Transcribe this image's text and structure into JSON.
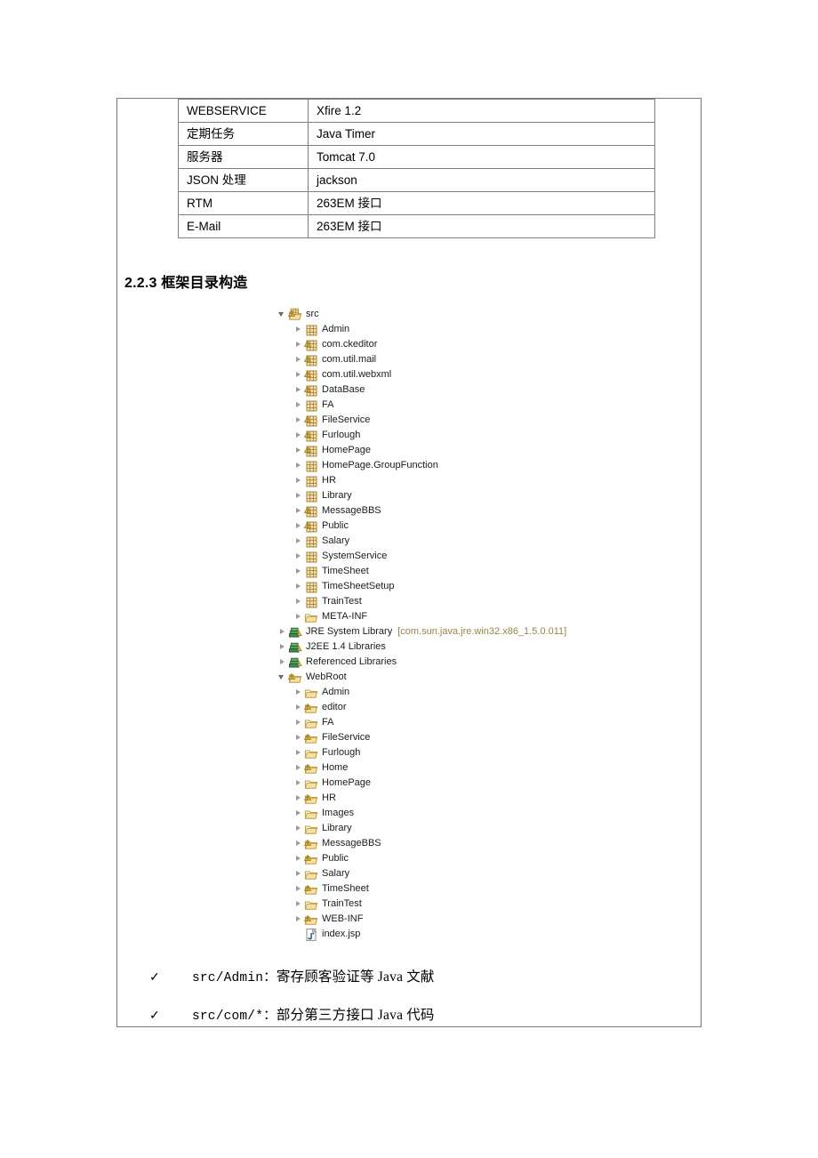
{
  "spec_table": {
    "rows": [
      {
        "key": "WEBSERVICE",
        "value": "Xfire 1.2"
      },
      {
        "key": "定期任务",
        "value": "Java Timer"
      },
      {
        "key": "服务器",
        "value": "Tomcat 7.0"
      },
      {
        "key": "JSON 处理",
        "value": "jackson"
      },
      {
        "key": "RTM",
        "value": "263EM 接口"
      },
      {
        "key": "E-Mail",
        "value": "263EM 接口"
      }
    ]
  },
  "heading": {
    "text": "2.2.3 框架目录构造"
  },
  "tree": {
    "nodes": [
      {
        "label": "src",
        "icon": "java-source-folder-icon",
        "state": "expanded",
        "indent": 0
      },
      {
        "label": "Admin",
        "icon": "package-icon",
        "state": "collapsed",
        "indent": 1
      },
      {
        "label": "com.ckeditor",
        "icon": "package-warning-icon",
        "state": "collapsed",
        "indent": 1
      },
      {
        "label": "com.util.mail",
        "icon": "package-warning-icon",
        "state": "collapsed",
        "indent": 1
      },
      {
        "label": "com.util.webxml",
        "icon": "package-warning-icon",
        "state": "collapsed",
        "indent": 1
      },
      {
        "label": "DataBase",
        "icon": "package-warning-icon",
        "state": "collapsed",
        "indent": 1
      },
      {
        "label": "FA",
        "icon": "package-icon",
        "state": "collapsed",
        "indent": 1
      },
      {
        "label": "FileService",
        "icon": "package-warning-icon",
        "state": "collapsed",
        "indent": 1
      },
      {
        "label": "Furlough",
        "icon": "package-warning-icon",
        "state": "collapsed",
        "indent": 1
      },
      {
        "label": "HomePage",
        "icon": "package-warning-icon",
        "state": "collapsed",
        "indent": 1
      },
      {
        "label": "HomePage.GroupFunction",
        "icon": "package-icon",
        "state": "collapsed",
        "indent": 1
      },
      {
        "label": "HR",
        "icon": "package-icon",
        "state": "collapsed",
        "indent": 1
      },
      {
        "label": "Library",
        "icon": "package-icon",
        "state": "collapsed",
        "indent": 1
      },
      {
        "label": "MessageBBS",
        "icon": "package-warning-icon",
        "state": "collapsed",
        "indent": 1
      },
      {
        "label": "Public",
        "icon": "package-warning-icon",
        "state": "collapsed",
        "indent": 1
      },
      {
        "label": "Salary",
        "icon": "package-icon",
        "state": "collapsed",
        "indent": 1
      },
      {
        "label": "SystemService",
        "icon": "package-icon",
        "state": "collapsed",
        "indent": 1
      },
      {
        "label": "TimeSheet",
        "icon": "package-icon",
        "state": "collapsed",
        "indent": 1
      },
      {
        "label": "TimeSheetSetup",
        "icon": "package-icon",
        "state": "collapsed",
        "indent": 1
      },
      {
        "label": "TrainTest",
        "icon": "package-icon",
        "state": "collapsed",
        "indent": 1
      },
      {
        "label": "META-INF",
        "icon": "folder-icon",
        "state": "collapsed",
        "indent": 1
      },
      {
        "label": "JRE System Library",
        "suffix": "[com.sun.java.jre.win32.x86_1.5.0.011]",
        "icon": "library-icon",
        "state": "collapsed",
        "indent": 0
      },
      {
        "label": "J2EE 1.4 Libraries",
        "icon": "library-icon",
        "state": "collapsed",
        "indent": 0
      },
      {
        "label": "Referenced Libraries",
        "icon": "library-icon",
        "state": "collapsed",
        "indent": 0
      },
      {
        "label": "WebRoot",
        "icon": "folder-warning-icon",
        "state": "expanded",
        "indent": 0
      },
      {
        "label": "Admin",
        "icon": "folder-icon",
        "state": "collapsed",
        "indent": 1
      },
      {
        "label": "editor",
        "icon": "folder-warning-icon",
        "state": "collapsed",
        "indent": 1
      },
      {
        "label": "FA",
        "icon": "folder-icon",
        "state": "collapsed",
        "indent": 1
      },
      {
        "label": "FileService",
        "icon": "folder-warning-icon",
        "state": "collapsed",
        "indent": 1
      },
      {
        "label": "Furlough",
        "icon": "folder-icon",
        "state": "collapsed",
        "indent": 1
      },
      {
        "label": "Home",
        "icon": "folder-warning-icon",
        "state": "collapsed",
        "indent": 1
      },
      {
        "label": "HomePage",
        "icon": "folder-icon",
        "state": "collapsed",
        "indent": 1
      },
      {
        "label": "HR",
        "icon": "folder-warning-icon",
        "state": "collapsed",
        "indent": 1
      },
      {
        "label": "Images",
        "icon": "folder-icon",
        "state": "collapsed",
        "indent": 1
      },
      {
        "label": "Library",
        "icon": "folder-icon",
        "state": "collapsed",
        "indent": 1
      },
      {
        "label": "MessageBBS",
        "icon": "folder-warning-icon",
        "state": "collapsed",
        "indent": 1
      },
      {
        "label": "Public",
        "icon": "folder-warning-icon",
        "state": "collapsed",
        "indent": 1
      },
      {
        "label": "Salary",
        "icon": "folder-icon",
        "state": "collapsed",
        "indent": 1
      },
      {
        "label": "TimeSheet",
        "icon": "folder-warning-icon",
        "state": "collapsed",
        "indent": 1
      },
      {
        "label": "TrainTest",
        "icon": "folder-icon",
        "state": "collapsed",
        "indent": 1
      },
      {
        "label": "WEB-INF",
        "icon": "folder-warning-icon",
        "state": "collapsed",
        "indent": 1
      },
      {
        "label": "index.jsp",
        "icon": "jsp-file-icon",
        "state": "leaf",
        "indent": 1
      }
    ]
  },
  "bullets": {
    "mark": "✓",
    "items": [
      {
        "code": "src/Admin：",
        "text": "寄存顾客验证等 Java 文献"
      },
      {
        "code": "src/com/*：",
        "text": "部分第三方接口 Java 代码"
      }
    ]
  }
}
